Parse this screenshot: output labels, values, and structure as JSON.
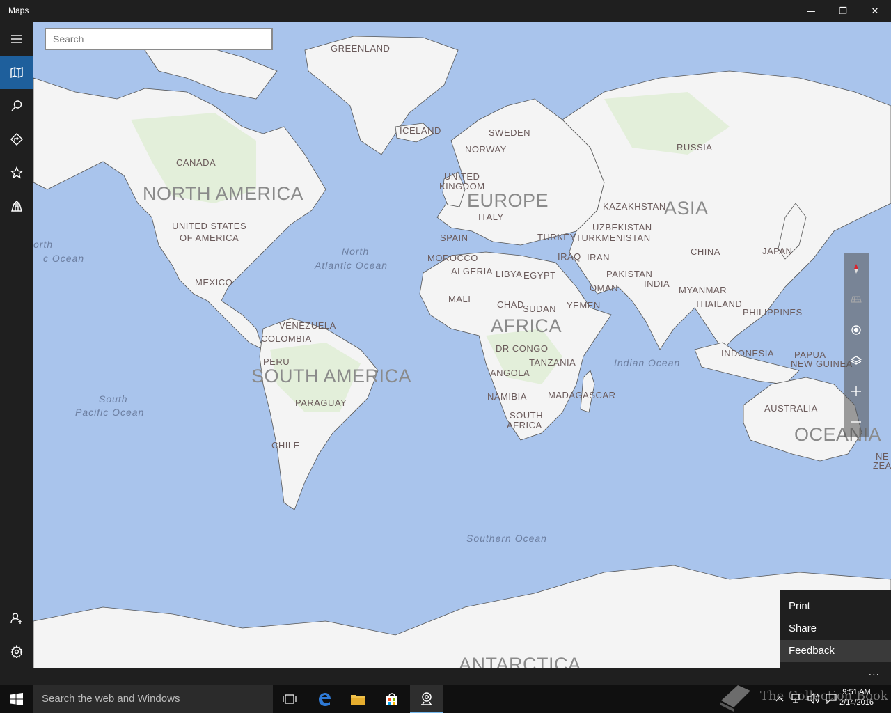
{
  "window": {
    "title": "Maps",
    "minimize": "—",
    "maximize": "❐",
    "close": "✕"
  },
  "nav": {
    "items": [
      {
        "name": "hamburger",
        "icon": "hamburger-icon"
      },
      {
        "name": "map",
        "icon": "map-icon",
        "active": true
      },
      {
        "name": "search",
        "icon": "search-icon"
      },
      {
        "name": "directions",
        "icon": "directions-icon"
      },
      {
        "name": "favorites",
        "icon": "star-icon"
      },
      {
        "name": "3d-cities",
        "icon": "3d-cities-icon"
      }
    ],
    "bottom": [
      {
        "name": "sign-in",
        "icon": "person-add-icon"
      },
      {
        "name": "settings",
        "icon": "gear-icon"
      }
    ]
  },
  "search": {
    "placeholder": "Search"
  },
  "map": {
    "continents": {
      "north_america": "NORTH AMERICA",
      "south_america": "SOUTH AMERICA",
      "europe": "EUROPE",
      "asia": "ASIA",
      "africa": "AFRICA",
      "oceania": "OCEANIA",
      "antarctica": "ANTARCTICA"
    },
    "countries": {
      "greenland": "GREENLAND",
      "canada": "CANADA",
      "usa_1": "UNITED STATES",
      "usa_2": "OF AMERICA",
      "mexico": "MEXICO",
      "venezuela": "VENEZUELA",
      "colombia": "COLOMBIA",
      "peru": "PERU",
      "paraguay": "PARAGUAY",
      "chile": "CHILE",
      "iceland": "ICELAND",
      "sweden": "SWEDEN",
      "norway": "NORWAY",
      "uk_1": "UNITED",
      "uk_2": "KINGDOM",
      "italy": "ITALY",
      "spain": "SPAIN",
      "morocco": "MOROCCO",
      "algeria": "ALGERIA",
      "libya": "LIBYA",
      "egypt": "EGYPT",
      "mali": "MALI",
      "chad": "CHAD",
      "sudan": "SUDAN",
      "yemen": "YEMEN",
      "dr_congo": "DR CONGO",
      "tanzania": "TANZANIA",
      "angola": "ANGOLA",
      "namibia": "NAMIBIA",
      "south_africa_1": "SOUTH",
      "south_africa_2": "AFRICA",
      "madagascar": "MADAGASCAR",
      "russia": "RUSSIA",
      "kazakhstan": "KAZAKHSTAN",
      "uzbekistan": "UZBEKISTAN",
      "turkmenistan": "TURKMENISTAN",
      "turkey": "TURKEY",
      "iraq": "IRAQ",
      "iran": "IRAN",
      "oman": "OMAN",
      "pakistan": "PAKISTAN",
      "india": "INDIA",
      "china": "CHINA",
      "japan": "JAPAN",
      "myanmar": "MYANMAR",
      "thailand": "THAILAND",
      "philippines": "PHILIPPINES",
      "indonesia": "INDONESIA",
      "papua_1": "PAPUA",
      "papua_2": "NEW GUINEA",
      "australia": "AUSTRALIA",
      "nz_1": "NE",
      "nz_2": "ZEAL"
    },
    "oceans": {
      "north_pacific_1": "orth",
      "north_pacific_2": "c Ocean",
      "north_atlantic_1": "North",
      "north_atlantic_2": "Atlantic Ocean",
      "south_pacific_1": "South",
      "south_pacific_2": "Pacific Ocean",
      "indian": "Indian Ocean",
      "southern": "Southern Ocean"
    }
  },
  "map_controls": [
    "compass-icon",
    "tilt-icon",
    "location-icon",
    "layers-icon",
    "zoom-in-icon",
    "zoom-out-icon"
  ],
  "menu": {
    "items": [
      "Print",
      "Share",
      "Feedback"
    ]
  },
  "appbar": {
    "more": "···"
  },
  "taskbar": {
    "search_text": "Search the web and Windows",
    "watermark": "The Collection Book",
    "time": "9:51 AM",
    "date": "2/14/2016"
  },
  "colors": {
    "ocean": "#a9c4ec",
    "land": "#f4f4f4",
    "accent": "#1e5f9c",
    "chrome": "#1f1f1f"
  }
}
